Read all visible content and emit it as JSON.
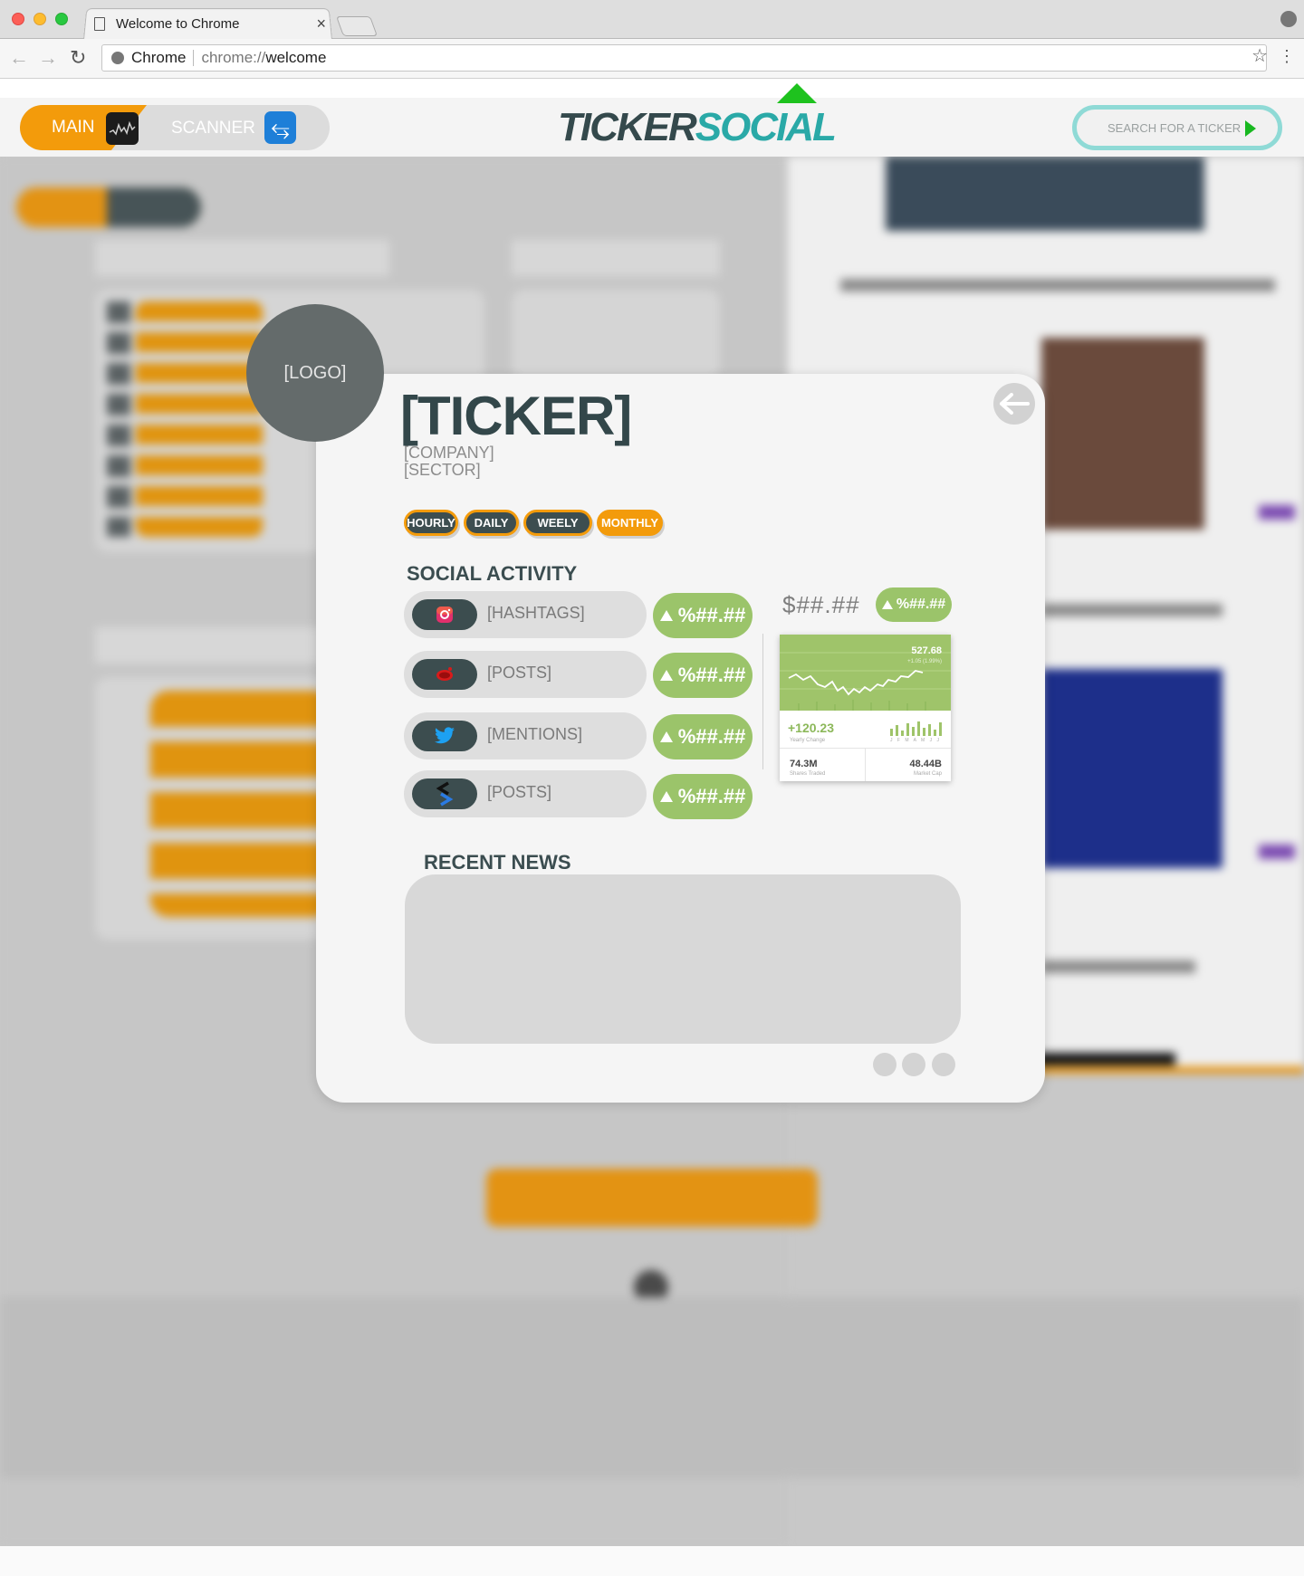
{
  "browser": {
    "tab_title": "Welcome to Chrome",
    "tab_close": "×",
    "omnibox_site": "Chrome",
    "url_scheme": "chrome://",
    "url_host": "welcome",
    "icons": [
      "page-icon",
      "back-arrow-icon",
      "forward-arrow-icon",
      "reload-icon",
      "site-info-icon",
      "star-icon",
      "menu-dots-icon",
      "profile-icon"
    ]
  },
  "header": {
    "main_label": "MAIN",
    "scanner_label": "SCANNER",
    "logo_part1": "TICKER",
    "logo_part2": "SOCIAL",
    "search_placeholder": "SEARCH FOR A TICKER",
    "colors": {
      "orange": "#f39b0b",
      "teal": "#2aa9a7",
      "dark_slate": "#34494c",
      "green": "#1ec21e"
    }
  },
  "modal": {
    "logo_placeholder": "[LOGO]",
    "ticker": "[TICKER]",
    "company": "[COMPANY]",
    "sector": "[SECTOR]",
    "periods": [
      {
        "label": "HOURLY",
        "active": false
      },
      {
        "label": "DAILY",
        "active": false
      },
      {
        "label": "WEELY",
        "active": false
      },
      {
        "label": "MONTHLY",
        "active": true
      }
    ],
    "social_title": "SOCIAL ACTIVITY",
    "social_rows": [
      {
        "platform": "instagram-icon",
        "label": "[HASHTAGS]",
        "change": "%##.##"
      },
      {
        "platform": "reddit-icon",
        "label": "[POSTS]",
        "change": "%##.##"
      },
      {
        "platform": "twitter-icon",
        "label": "[MENTIONS]",
        "change": "%##.##"
      },
      {
        "platform": "stocktwits-icon",
        "label": "[POSTS]",
        "change": "%##.##"
      }
    ],
    "price": "$##.##",
    "price_change": "%##.##",
    "stock_card": {
      "price": "527.68",
      "price_sub": "+1.05 (1.99%)",
      "yearly_change": "+120.23",
      "yearly_change_label": "Yearly Change",
      "months": "J F M A M J J",
      "shares_traded": "74.3M",
      "shares_traded_label": "Shares Traded",
      "market_cap": "48.44B",
      "market_cap_label": "Market Cap"
    },
    "news_title": "RECENT NEWS",
    "page_dots": 3,
    "colors": {
      "green_pill": "#9bc46a",
      "slate": "#3c4d4f",
      "orange": "#f39b0b"
    }
  }
}
